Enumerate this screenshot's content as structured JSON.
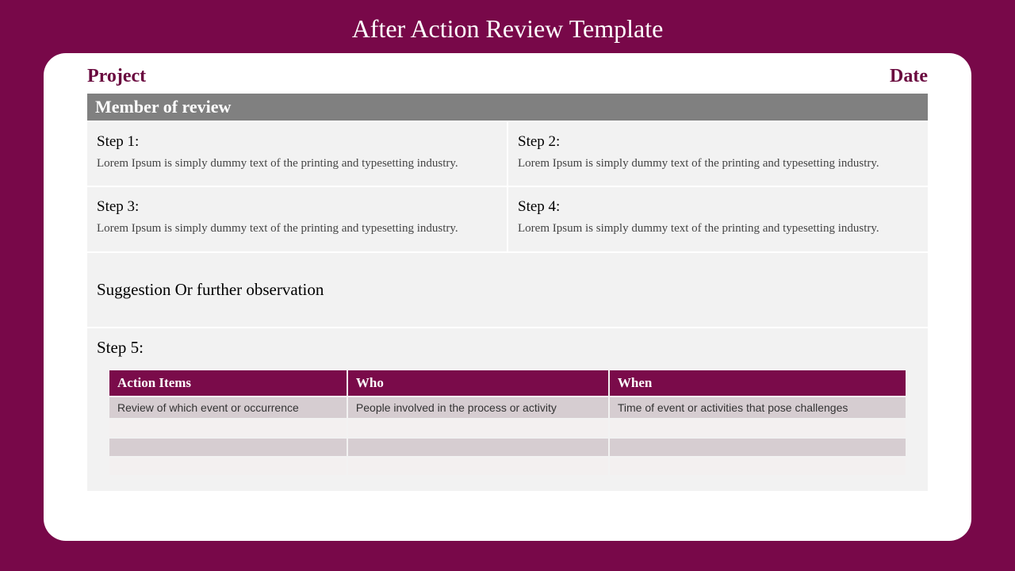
{
  "title": "After Action Review Template",
  "header": {
    "project": "Project",
    "date": "Date"
  },
  "memberBar": "Member of review",
  "steps": [
    {
      "title": "Step 1:",
      "body": "Lorem Ipsum is simply dummy text of the printing and typesetting industry."
    },
    {
      "title": "Step 2:",
      "body": "Lorem Ipsum is simply dummy text of the printing and typesetting industry."
    },
    {
      "title": "Step 3:",
      "body": "Lorem Ipsum is simply dummy text of the printing and typesetting industry."
    },
    {
      "title": "Step 4:",
      "body": "Lorem Ipsum is simply dummy text of the printing and typesetting industry."
    }
  ],
  "suggestion": "Suggestion Or further observation",
  "step5": {
    "title": "Step 5:"
  },
  "table": {
    "headers": [
      "Action Items",
      "Who",
      "When"
    ],
    "rows": [
      [
        "Review of which event or occurrence",
        "People involved in the process or activity",
        "Time of event or activities that pose challenges"
      ],
      [
        "",
        "",
        ""
      ],
      [
        "",
        "",
        ""
      ],
      [
        "",
        "",
        ""
      ]
    ]
  }
}
